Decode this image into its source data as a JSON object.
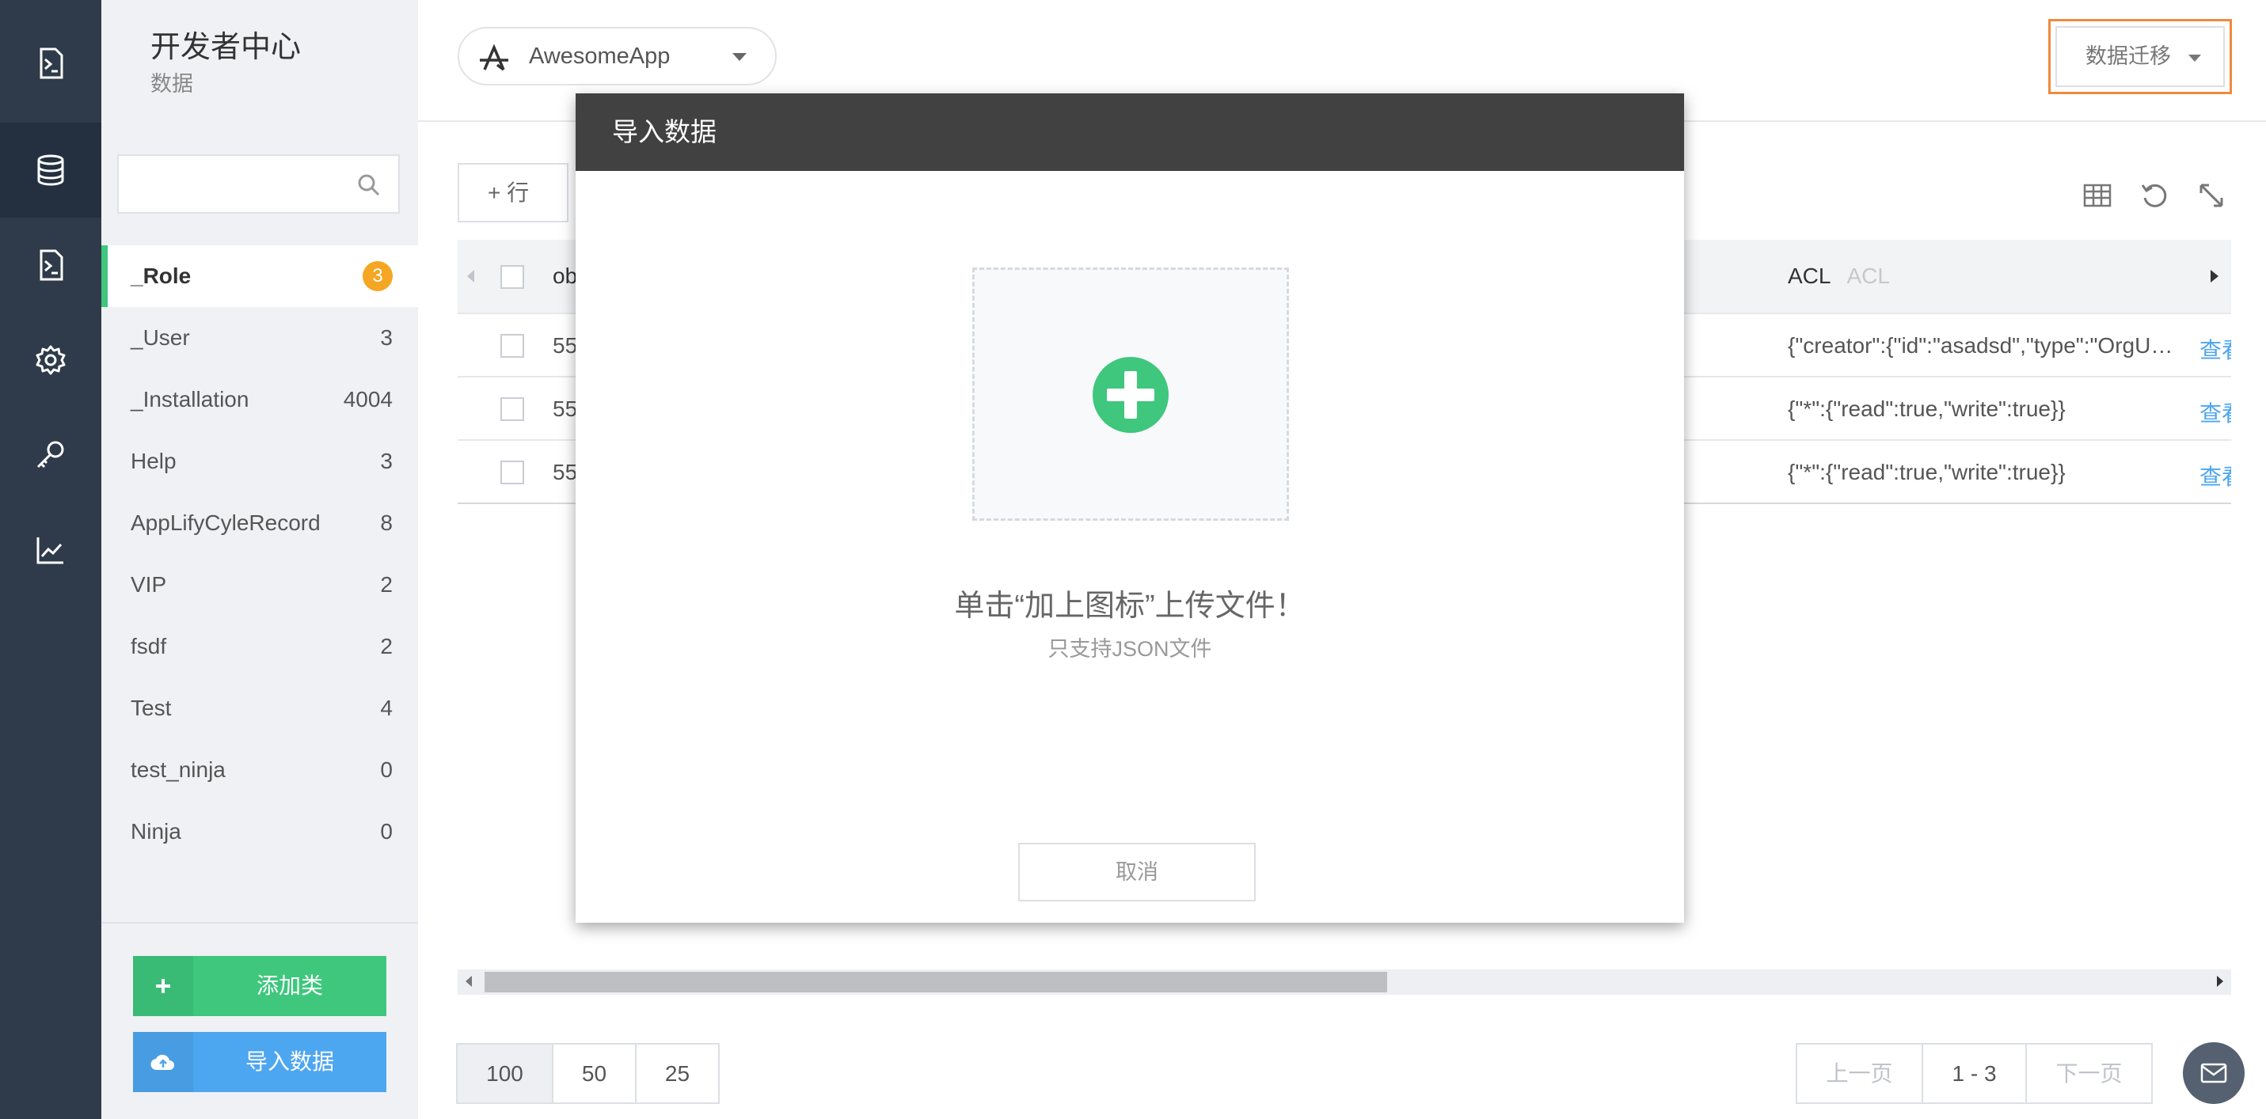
{
  "rail": {
    "items": [
      {
        "icon": "console-icon"
      },
      {
        "icon": "database-icon",
        "active": true
      },
      {
        "icon": "document-icon"
      },
      {
        "icon": "gear-icon"
      },
      {
        "icon": "key-icon"
      },
      {
        "icon": "chart-icon"
      }
    ]
  },
  "sidebar": {
    "title": "开发者中心",
    "subtitle": "数据",
    "search": {
      "placeholder": "",
      "value": ""
    },
    "classes": [
      {
        "name": "_Role",
        "count": "3",
        "active": true
      },
      {
        "name": "_User",
        "count": "3"
      },
      {
        "name": "_Installation",
        "count": "4004"
      },
      {
        "name": "Help",
        "count": "3"
      },
      {
        "name": "AppLifyCyleRecord",
        "count": "8"
      },
      {
        "name": "VIP",
        "count": "2"
      },
      {
        "name": "fsdf",
        "count": "2"
      },
      {
        "name": "Test",
        "count": "4"
      },
      {
        "name": "test_ninja",
        "count": "0"
      },
      {
        "name": "Ninja",
        "count": "0"
      }
    ],
    "add_class_label": "添加类",
    "import_label": "导入数据"
  },
  "header": {
    "app_name": "AwesomeApp",
    "migrate_label": "数据迁移"
  },
  "toolbar": {
    "add_row_label": "行"
  },
  "table": {
    "header": {
      "id": "ob",
      "acl": "ACL",
      "acl_type": "ACL"
    },
    "rows": [
      {
        "id": "55",
        "acl": "{\"creator\":{\"id\":\"asadsd\",\"type\":\"OrgUser\"}}",
        "view": "查看"
      },
      {
        "id": "55",
        "acl": "{\"*\":{\"read\":true,\"write\":true}}",
        "view": "查看"
      },
      {
        "id": "55",
        "acl": "{\"*\":{\"read\":true,\"write\":true}}",
        "view": "查看"
      }
    ]
  },
  "pagination": {
    "page_sizes": [
      "100",
      "50",
      "25"
    ],
    "selected_page_size": "100",
    "prev_label": "上一页",
    "range": "1 - 3",
    "next_label": "下一页"
  },
  "modal": {
    "title": "导入数据",
    "upload_title": "单击“加上图标”上传文件！",
    "upload_sub": "只支持JSON文件",
    "cancel_label": "取消"
  },
  "colors": {
    "accent_green": "#3ec77d",
    "accent_blue": "#4da6f0",
    "badge_orange": "#f5a623",
    "highlight_orange": "#f08a3c",
    "rail_bg": "#2f3b4a",
    "modal_header_bg": "#414141"
  }
}
